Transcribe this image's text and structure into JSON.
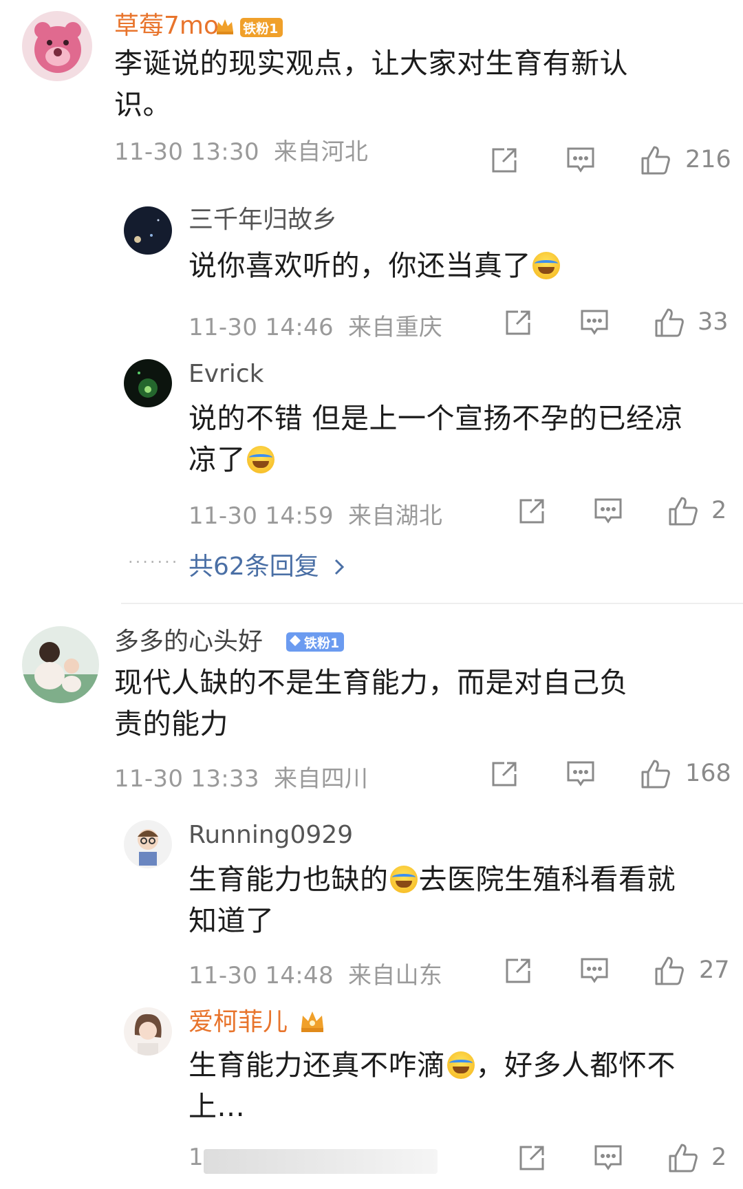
{
  "comments": [
    {
      "user": "草莓7mo",
      "badge": "铁粉1",
      "text": "李诞说的现实观点，让大家对生育有新认识。",
      "time": "11-30 13:30",
      "location": "来自河北",
      "likes": "216",
      "replies": [
        {
          "user": "三千年归故乡",
          "text": "说你喜欢听的，你还当真了",
          "time": "11-30 14:46",
          "location": "来自重庆",
          "likes": "33"
        },
        {
          "user": "Evrick",
          "text_line1": "说的不错 但是上一个宣扬不孕的已经凉",
          "text_line2": "凉了",
          "time": "11-30 14:59",
          "location": "来自湖北",
          "likes": "2"
        }
      ],
      "more_replies": "共62条回复"
    },
    {
      "user": "多多的心头好",
      "badge": "铁粉1",
      "text": "现代人缺的不是生育能力，而是对自己负责的能力",
      "time": "11-30 13:33",
      "location": "来自四川",
      "likes": "168",
      "replies": [
        {
          "user": "Running0929",
          "text_part1": "生育能力也缺的",
          "text_part2": "去医院生殖科看看就",
          "text_line2": "知道了",
          "time": "11-30 14:48",
          "location": "来自山东",
          "likes": "27"
        },
        {
          "user": "爱柯菲儿",
          "text_part1": "生育能力还真不咋滴",
          "text_part2": "，好多人都怀不",
          "text_line2": "上...",
          "time": "1",
          "likes": "2"
        }
      ]
    }
  ],
  "icons": {
    "share": "share-icon",
    "comment": "comment-icon",
    "like": "thumbs-up-icon",
    "emoji": "laugh-cry-emoji-icon",
    "chevron": "chevron-right-icon"
  },
  "colors": {
    "username_orange": "#e8742c",
    "link_blue": "#4a6fa5",
    "meta_gray": "#9a9a9a"
  }
}
